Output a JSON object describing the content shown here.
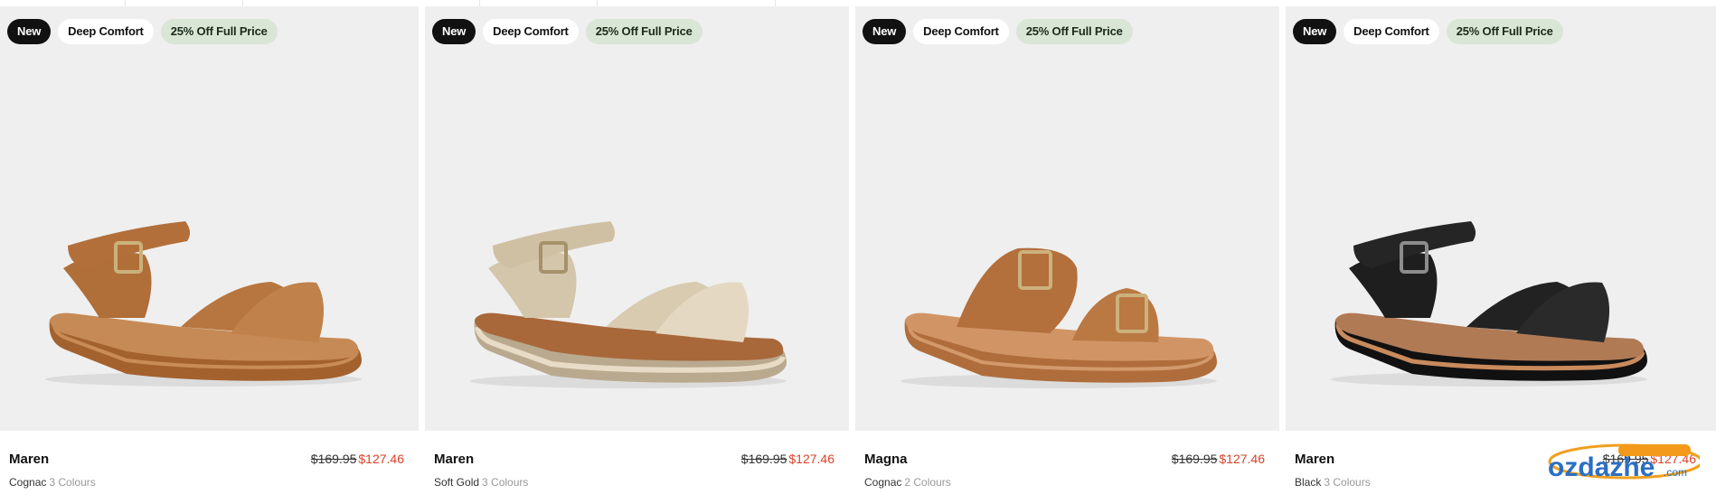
{
  "colors": {
    "image_bg": "#efefef",
    "sale_price": "#d9432a",
    "sale_badge_bg": "#d9e6d6",
    "new_badge_bg": "#111111"
  },
  "products": [
    {
      "badges": [
        "New",
        "Deep Comfort",
        "25% Off Full Price"
      ],
      "name": "Maren",
      "colour": "Cognac",
      "colour_count": "3 Colours",
      "old_price": "$169.95",
      "price": "$127.46",
      "shoe_style": "sandal-cross-strap",
      "shoe_color": "#b5743e"
    },
    {
      "badges": [
        "New",
        "Deep Comfort",
        "25% Off Full Price"
      ],
      "name": "Maren",
      "colour": "Soft Gold",
      "colour_count": "3 Colours",
      "old_price": "$169.95",
      "price": "$127.46",
      "shoe_style": "sandal-cross-strap",
      "shoe_color": "#d8c8a8"
    },
    {
      "badges": [
        "New",
        "Deep Comfort",
        "25% Off Full Price"
      ],
      "name": "Magna",
      "colour": "Cognac",
      "colour_count": "2 Colours",
      "old_price": "$169.95",
      "price": "$127.46",
      "shoe_style": "slide-buckle",
      "shoe_color": "#b5743e"
    },
    {
      "badges": [
        "New",
        "Deep Comfort",
        "25% Off Full Price"
      ],
      "name": "Maren",
      "colour": "Black",
      "colour_count": "3 Colours",
      "old_price": "$169.95",
      "price": "$127.46",
      "shoe_style": "sandal-cross-strap",
      "shoe_color": "#1c1c1c"
    }
  ],
  "watermark": {
    "text": "ozdazhe",
    "suffix": ".com"
  }
}
